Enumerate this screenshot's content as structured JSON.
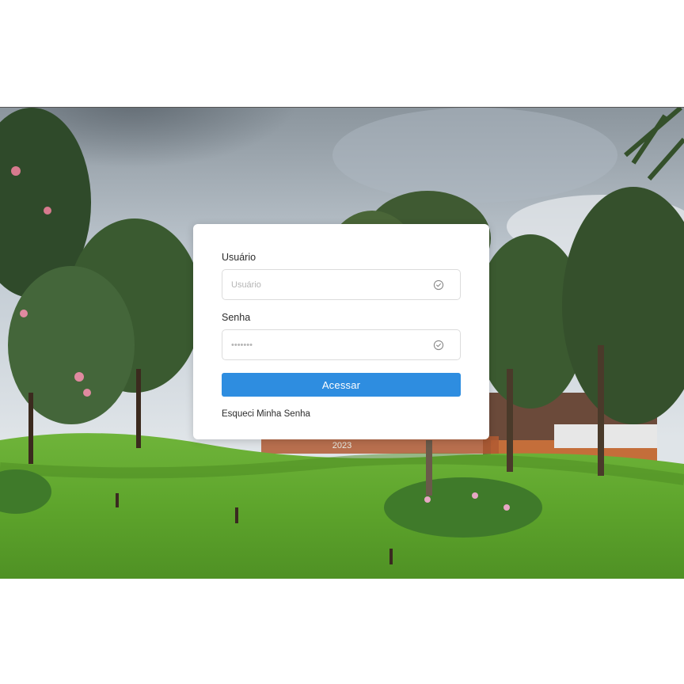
{
  "login": {
    "username_label": "Usuário",
    "username_placeholder": "Usuário",
    "password_label": "Senha",
    "password_placeholder": "•••••••",
    "submit_label": "Acessar",
    "forgot_link": "Esqueci Minha Senha",
    "field_icon": "check-circle-icon"
  },
  "footer": {
    "year": "2023"
  },
  "colors": {
    "accent": "#2e8de0",
    "grass": "#5fa832",
    "sky": "#c9d3dc"
  }
}
